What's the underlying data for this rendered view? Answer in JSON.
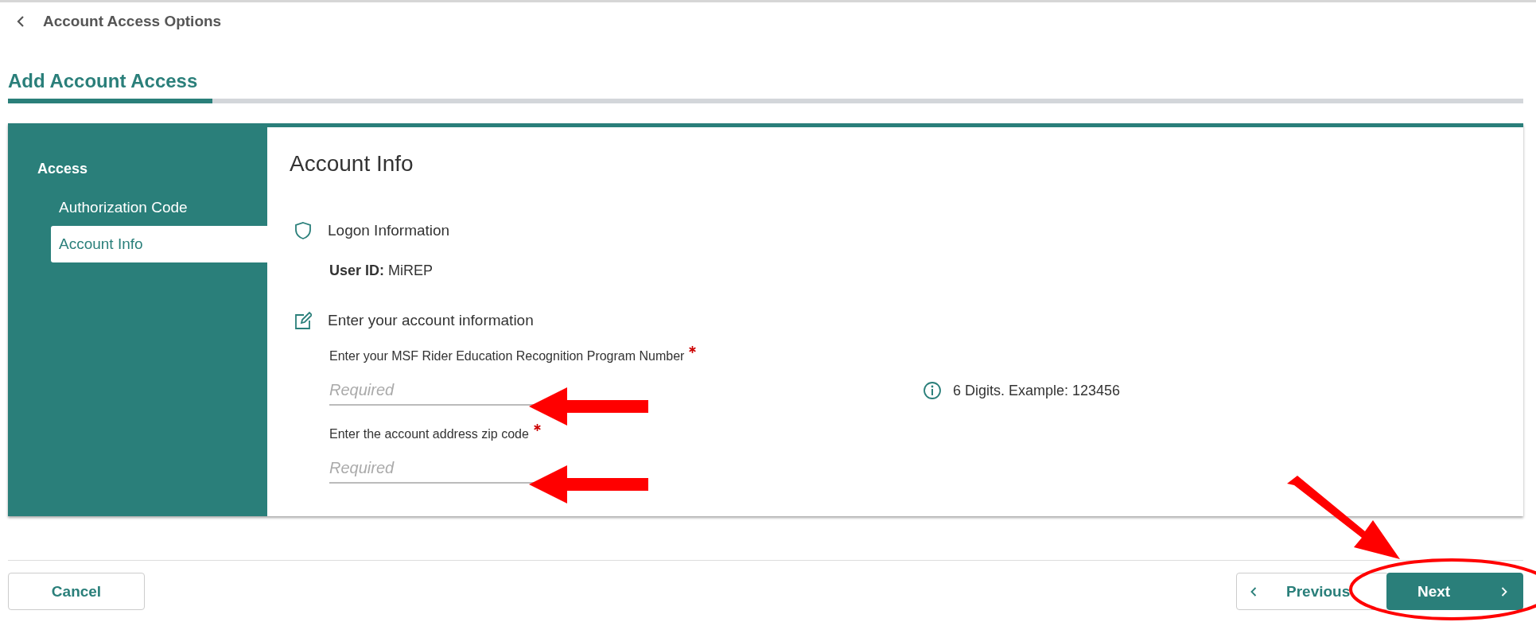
{
  "back_link": {
    "label": "Account Access Options"
  },
  "page_title": "Add Account Access",
  "progress": {
    "level": 0.135
  },
  "sidebar": {
    "heading": "Access",
    "items": [
      {
        "label": "Authorization Code",
        "selected": false
      },
      {
        "label": "Account Info",
        "selected": true
      }
    ]
  },
  "main": {
    "title": "Account Info",
    "sections": [
      {
        "kind": "logon",
        "heading": "Logon Information",
        "user_id_label": "User ID:",
        "user_id": "MiREP"
      },
      {
        "kind": "form",
        "heading": "Enter your account information",
        "fields": [
          {
            "label": "Enter your MSF Rider Education Recognition Program Number",
            "required": true,
            "placeholder": "Required",
            "hint": "6 Digits. Example: 123456",
            "marked": true
          },
          {
            "label": "Enter the account address zip code",
            "required": true,
            "placeholder": "Required",
            "marked": true
          }
        ]
      }
    ]
  },
  "footer": {
    "cancel": "Cancel",
    "previous": "Previous",
    "next": "Next",
    "next_marked": true
  }
}
